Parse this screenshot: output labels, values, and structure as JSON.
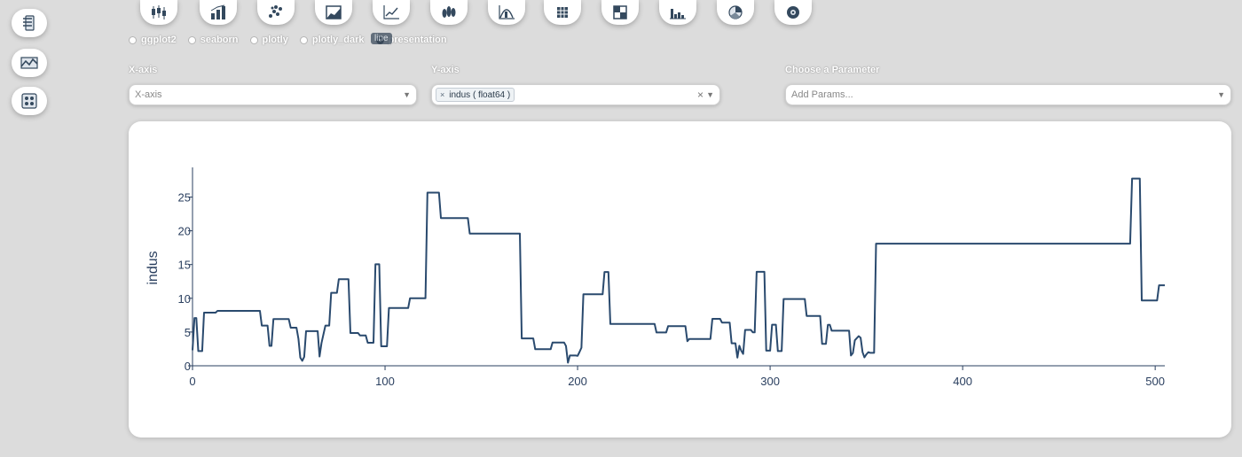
{
  "sidebar": {
    "items": [
      {
        "icon": "data-table-icon"
      },
      {
        "icon": "landscape-chart-icon"
      },
      {
        "icon": "network-icon"
      }
    ]
  },
  "toolbar": {
    "buttons": [
      {
        "icon": "candlestick-icon"
      },
      {
        "icon": "bar-chart-icon"
      },
      {
        "icon": "scatter-plot-icon"
      },
      {
        "icon": "area-chart-icon"
      },
      {
        "icon": "line-chart-icon"
      },
      {
        "icon": "violin-plot-icon"
      },
      {
        "icon": "distribution-icon"
      },
      {
        "icon": "heatmap-icon"
      },
      {
        "icon": "table-grid-icon"
      },
      {
        "icon": "histogram-icon"
      },
      {
        "icon": "pie-chart-icon"
      },
      {
        "icon": "settings-circle-icon"
      }
    ],
    "tooltip": "line"
  },
  "themes": {
    "options": [
      "ggplot2",
      "seaborn",
      "plotly",
      "plotly_dark",
      "presentation"
    ],
    "selected": "presentation"
  },
  "selectors": {
    "x_label": "X-axis",
    "x_placeholder": "X-axis",
    "y_label": "Y-axis",
    "y_tag": "indus ( float64 )",
    "param_label": "Choose a Parameter",
    "param_placeholder": "Add Params..."
  },
  "colors": {
    "line": "#2a4a6e",
    "axis_text": "#2a3f5f",
    "background": "#dcdcdc"
  },
  "chart_data": {
    "type": "line",
    "ylabel": "indus",
    "xlim": [
      0,
      505
    ],
    "ylim": [
      0,
      29
    ],
    "x_ticks": [
      0,
      100,
      200,
      300,
      400,
      500
    ],
    "y_ticks": [
      0,
      5,
      10,
      15,
      20,
      25
    ],
    "series": [
      {
        "points": [
          [
            0,
            2.31
          ],
          [
            1,
            7.07
          ],
          [
            2,
            7.07
          ],
          [
            3,
            2.18
          ],
          [
            4,
            2.18
          ],
          [
            5,
            2.18
          ],
          [
            6,
            7.87
          ],
          [
            12,
            7.87
          ],
          [
            13,
            8.14
          ],
          [
            35,
            8.14
          ],
          [
            36,
            5.96
          ],
          [
            39,
            5.96
          ],
          [
            40,
            2.95
          ],
          [
            41,
            2.95
          ],
          [
            42,
            6.91
          ],
          [
            50,
            6.91
          ],
          [
            51,
            5.64
          ],
          [
            54,
            5.64
          ],
          [
            55,
            4.0
          ],
          [
            56,
            1.22
          ],
          [
            57,
            0.74
          ],
          [
            58,
            1.32
          ],
          [
            59,
            5.13
          ],
          [
            65,
            5.13
          ],
          [
            66,
            1.38
          ],
          [
            67,
            3.37
          ],
          [
            69,
            5.96
          ],
          [
            71,
            5.96
          ],
          [
            72,
            10.81
          ],
          [
            75,
            10.81
          ],
          [
            76,
            12.83
          ],
          [
            81,
            12.83
          ],
          [
            82,
            4.86
          ],
          [
            86,
            4.86
          ],
          [
            87,
            4.49
          ],
          [
            90,
            4.49
          ],
          [
            91,
            3.41
          ],
          [
            94,
            3.41
          ],
          [
            95,
            15.04
          ],
          [
            97,
            15.04
          ],
          [
            98,
            2.89
          ],
          [
            101,
            2.89
          ],
          [
            102,
            8.56
          ],
          [
            112,
            8.56
          ],
          [
            113,
            10.01
          ],
          [
            121,
            10.01
          ],
          [
            122,
            25.65
          ],
          [
            128,
            25.65
          ],
          [
            129,
            21.89
          ],
          [
            143,
            21.89
          ],
          [
            144,
            19.58
          ],
          [
            170,
            19.58
          ],
          [
            171,
            4.05
          ],
          [
            177,
            4.05
          ],
          [
            178,
            2.46
          ],
          [
            186,
            2.46
          ],
          [
            187,
            3.44
          ],
          [
            193,
            3.44
          ],
          [
            194,
            2.93
          ],
          [
            195,
            0.46
          ],
          [
            196,
            1.52
          ],
          [
            199,
            1.52
          ],
          [
            200,
            1.47
          ],
          [
            201,
            2.03
          ],
          [
            202,
            2.68
          ],
          [
            203,
            10.59
          ],
          [
            213,
            10.59
          ],
          [
            214,
            13.89
          ],
          [
            216,
            13.89
          ],
          [
            217,
            6.2
          ],
          [
            240,
            6.2
          ],
          [
            241,
            4.93
          ],
          [
            246,
            4.93
          ],
          [
            247,
            5.86
          ],
          [
            256,
            5.86
          ],
          [
            257,
            3.64
          ],
          [
            258,
            3.97
          ],
          [
            269,
            3.97
          ],
          [
            270,
            6.96
          ],
          [
            274,
            6.96
          ],
          [
            275,
            6.41
          ],
          [
            279,
            6.41
          ],
          [
            280,
            3.33
          ],
          [
            282,
            3.33
          ],
          [
            283,
            1.21
          ],
          [
            284,
            2.97
          ],
          [
            285,
            2.25
          ],
          [
            286,
            1.76
          ],
          [
            287,
            5.32
          ],
          [
            290,
            5.32
          ],
          [
            291,
            4.95
          ],
          [
            292,
            4.95
          ],
          [
            293,
            13.92
          ],
          [
            297,
            13.92
          ],
          [
            298,
            2.24
          ],
          [
            300,
            2.24
          ],
          [
            301,
            6.09
          ],
          [
            303,
            6.09
          ],
          [
            304,
            2.18
          ],
          [
            306,
            2.18
          ],
          [
            307,
            9.9
          ],
          [
            318,
            9.9
          ],
          [
            319,
            7.38
          ],
          [
            326,
            7.38
          ],
          [
            327,
            3.24
          ],
          [
            329,
            3.24
          ],
          [
            330,
            6.06
          ],
          [
            331,
            6.06
          ],
          [
            332,
            5.19
          ],
          [
            341,
            5.19
          ],
          [
            342,
            1.52
          ],
          [
            343,
            1.89
          ],
          [
            344,
            3.78
          ],
          [
            346,
            4.39
          ],
          [
            347,
            4.15
          ],
          [
            348,
            2.01
          ],
          [
            349,
            1.25
          ],
          [
            350,
            1.69
          ],
          [
            351,
            2.02
          ],
          [
            352,
            1.91
          ],
          [
            354,
            1.91
          ],
          [
            355,
            18.1
          ],
          [
            487,
            18.1
          ],
          [
            488,
            27.74
          ],
          [
            492,
            27.74
          ],
          [
            493,
            9.69
          ],
          [
            501,
            9.69
          ],
          [
            502,
            11.93
          ],
          [
            505,
            11.93
          ]
        ]
      }
    ]
  }
}
